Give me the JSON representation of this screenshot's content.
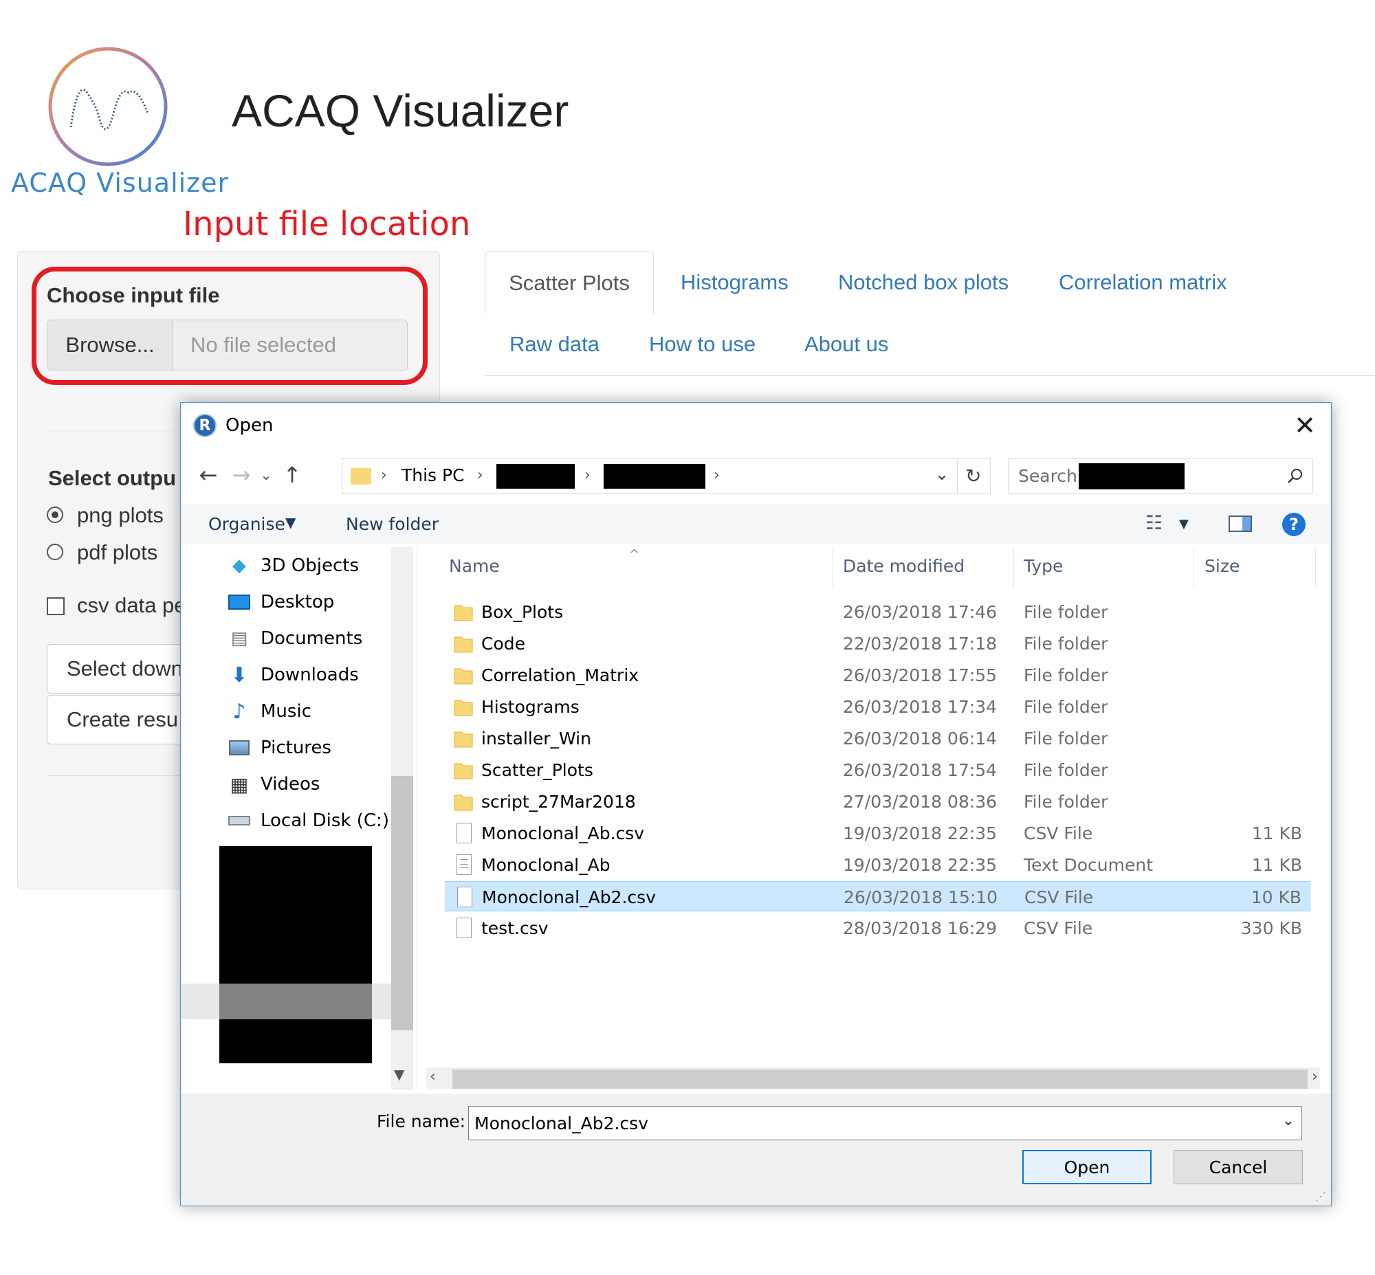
{
  "app": {
    "title": "ACAQ Visualizer",
    "logo_text": "ACAQ Visualizer",
    "annotation": "Input file location"
  },
  "sidebar": {
    "file_input": {
      "label": "Choose input file",
      "button": "Browse...",
      "status": "No file selected"
    },
    "output_label": "Select outpu",
    "radios": [
      {
        "label": "png plots",
        "checked": true
      },
      {
        "label": "pdf plots",
        "checked": false
      }
    ],
    "checkbox_label": "csv data pe",
    "buttons": [
      "Select down",
      "Create resu"
    ]
  },
  "tabs": [
    {
      "label": "Scatter Plots",
      "active": true
    },
    {
      "label": "Histograms"
    },
    {
      "label": "Notched box plots"
    },
    {
      "label": "Correlation matrix"
    },
    {
      "label": "Raw data"
    },
    {
      "label": "How to use"
    },
    {
      "label": "About us"
    }
  ],
  "dialog": {
    "title": "Open",
    "address": {
      "root": "This PC"
    },
    "search_placeholder": "Search",
    "toolbar": {
      "organise": "Organise",
      "new_folder": "New folder"
    },
    "nav_items": [
      {
        "label": "3D Objects",
        "icon": "cube-icon"
      },
      {
        "label": "Desktop",
        "icon": "desktop-icon"
      },
      {
        "label": "Documents",
        "icon": "document-icon"
      },
      {
        "label": "Downloads",
        "icon": "download-icon"
      },
      {
        "label": "Music",
        "icon": "music-icon"
      },
      {
        "label": "Pictures",
        "icon": "picture-icon"
      },
      {
        "label": "Videos",
        "icon": "video-icon"
      },
      {
        "label": "Local Disk (C:)",
        "icon": "drive-icon"
      }
    ],
    "columns": [
      "Name",
      "Date modified",
      "Type",
      "Size"
    ],
    "files": [
      {
        "name": "Box_Plots",
        "date": "26/03/2018 17:46",
        "type": "File folder",
        "size": "",
        "kind": "folder"
      },
      {
        "name": "Code",
        "date": "22/03/2018 17:18",
        "type": "File folder",
        "size": "",
        "kind": "folder"
      },
      {
        "name": "Correlation_Matrix",
        "date": "26/03/2018 17:55",
        "type": "File folder",
        "size": "",
        "kind": "folder"
      },
      {
        "name": "Histograms",
        "date": "26/03/2018 17:34",
        "type": "File folder",
        "size": "",
        "kind": "folder"
      },
      {
        "name": "installer_Win",
        "date": "26/03/2018 06:14",
        "type": "File folder",
        "size": "",
        "kind": "folder"
      },
      {
        "name": "Scatter_Plots",
        "date": "26/03/2018 17:54",
        "type": "File folder",
        "size": "",
        "kind": "folder"
      },
      {
        "name": "script_27Mar2018",
        "date": "27/03/2018 08:36",
        "type": "File folder",
        "size": "",
        "kind": "folder"
      },
      {
        "name": "Monoclonal_Ab.csv",
        "date": "19/03/2018 22:35",
        "type": "CSV File",
        "size": "11 KB",
        "kind": "file"
      },
      {
        "name": "Monoclonal_Ab",
        "date": "19/03/2018 22:35",
        "type": "Text Document",
        "size": "11 KB",
        "kind": "text"
      },
      {
        "name": "Monoclonal_Ab2.csv",
        "date": "26/03/2018 15:10",
        "type": "CSV File",
        "size": "10 KB",
        "kind": "file",
        "selected": true
      },
      {
        "name": "test.csv",
        "date": "28/03/2018 16:29",
        "type": "CSV File",
        "size": "330 KB",
        "kind": "file"
      }
    ],
    "file_name_label": "File name:",
    "file_name_value": "Monoclonal_Ab2.csv",
    "open_button": "Open",
    "cancel_button": "Cancel"
  },
  "colors": {
    "accent_red": "#e31b23",
    "link": "#337ab7",
    "selection": "#cce8ff"
  }
}
